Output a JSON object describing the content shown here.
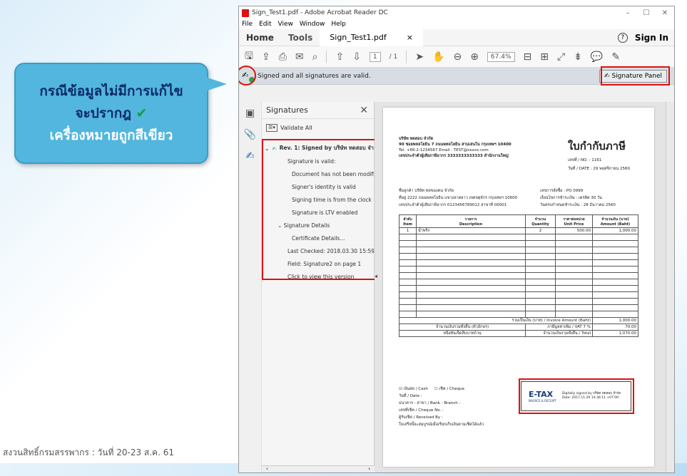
{
  "callout": {
    "line1": "กรณีข้อมูลไม่มีการแก้ไข",
    "line2": "จะปรากฎ",
    "check": "✔",
    "line3": "เครื่องหมายถูกสีเขียว"
  },
  "footer_caption": "สงวนสิทธิ์กรมสรรพากร : วันที่ 20-23 ส.ค. 61",
  "window": {
    "title": "Sign_Test1.pdf - Adobe Acrobat Reader DC",
    "menu": [
      "File",
      "Edit",
      "View",
      "Window",
      "Help"
    ],
    "tabs": {
      "home": "Home",
      "tools": "Tools",
      "document": "Sign_Test1.pdf",
      "close": "×",
      "sign_in": "Sign In",
      "help": "?"
    },
    "toolbar": {
      "page_current": "1",
      "page_total": "/ 1",
      "zoom": "67.4%"
    },
    "signature_bar": {
      "message": "Signed and all signatures are valid.",
      "panel_button": "Signature Panel"
    }
  },
  "signature_panel": {
    "title": "Signatures",
    "close": "✕",
    "validate_all": "Validate All",
    "revision": "Rev. 1: Signed by บริษัท ทดสอบ จำกัด",
    "items": [
      {
        "level": 1,
        "text": "Signature is valid:"
      },
      {
        "level": 2,
        "text": "Document has not been modified"
      },
      {
        "level": 2,
        "text": "Signer's identity is valid"
      },
      {
        "level": 2,
        "text": "Signing time is from the clock"
      },
      {
        "level": 2,
        "text": "Signature is LTV enabled"
      },
      {
        "level": 0,
        "text": "Signature Details"
      },
      {
        "level": 2,
        "text": "Certificate Details..."
      },
      {
        "level": 1,
        "text": "Last Checked: 2018.03.30 15:59:2"
      },
      {
        "level": 1,
        "text": "Field: Signature2 on page 1"
      },
      {
        "level": 1,
        "text": "Click to view this version"
      }
    ]
  },
  "invoice": {
    "company_name": "บริษัท ทดสอบ จำกัด",
    "company_address": "90 ซอยพหลโยธิน 7 ถนนพหลโยธิน สามเสนใน กรุงเทพฯ 10400",
    "company_contact": "Tel. +66-2-1234567     Email : TEST@xxxxx.com",
    "company_taxid": "เลขประจำตัวผู้เสียภาษีอากร 3333333333333     สำนักงานใหญ่",
    "title": "ใบกำกับภาษี",
    "doc_no": "เลขที่ / NO. :    1161",
    "doc_date": "วันที่ / DATE :   29 พฤศจิกายน 2560",
    "customer_name": "ชื่อลูกค้า  บริษัท ทดของคน จำกัด",
    "customer_address": "ที่อยู่  2222 ถนนพหลโยธิน แขวงลาดยาว เขตจตุจักร กรุงเทพฯ 10600",
    "customer_taxid": "เลขประจำตัวผู้เสียภาษีอากร 0123456789012   สาขาที่ 00001",
    "po_no": "เลขการสั่งซื้อ :    PO 0999",
    "credit_terms": "เงื่อนไขการชำระเงิน :  เครดิต 30 วัน",
    "due_date": "วันครบกำหนดชำระเงิน :  28 ธันวาคม 2560",
    "table_headers": [
      "ลำดับ\nItem",
      "รายการ\nDescription",
      "จำนวน\nQuantity",
      "ราคาต่อหน่วย\nUnit Price",
      "จำนวนเงิน (บาท)\nAmount (Baht)"
    ],
    "rows": [
      {
        "item": "1",
        "description": "น้ำพริก",
        "quantity": "2",
        "unit_price": "500.00",
        "amount": "1,000.00"
      }
    ],
    "total_label": "รวมเป็นเงิน (บาท) / Invoice Amount (Baht)",
    "total_value": "1,000.00",
    "words_label": "จำนวนเงินรวมทั้งสิ้น (ตัวอักษร)",
    "words_value": "หนึ่งพันเจ็ดสิบบาทถ้วน",
    "vat_label": "ภาษีมูลค่าเพิ่ม / VAT 7 %",
    "vat_value": "70.00",
    "grand_label": "จำนวนเงินรวมทั้งสิ้น / Total",
    "grand_value": "1,070.00",
    "pay_cash": "เงินสด / Cash",
    "pay_cheque": "เช็ค / Cheque",
    "pay_date": "วันที่ / Date :",
    "pay_bank": "ธนาคาร - สาขา / Bank - Branch :",
    "pay_chequeno": "เลขที่เช็ค / Cheque No. :",
    "pay_receiver": "ผู้รับเช็ค / Received By :",
    "pay_note": "ใบเสร็จนี้จะสมบูรณ์เมื่อเรียกเก็บเงินตามเช็คได้แล้ว",
    "etax_logo": "E-TAX",
    "etax_sub": "INVOICE & RECEIPT",
    "etax_signed": "Digitally signed by บริษัท ทดสอบ จำกัด",
    "etax_date": "Date: 2017.11.29 14:36:11 +07'00'"
  },
  "colors": {
    "callout_bg": "#52b6de",
    "callout_text": "#0b2a66",
    "check_green": "#1a9b3a",
    "highlight_red": "#dd1111",
    "valid_green": "#2aa34a"
  }
}
